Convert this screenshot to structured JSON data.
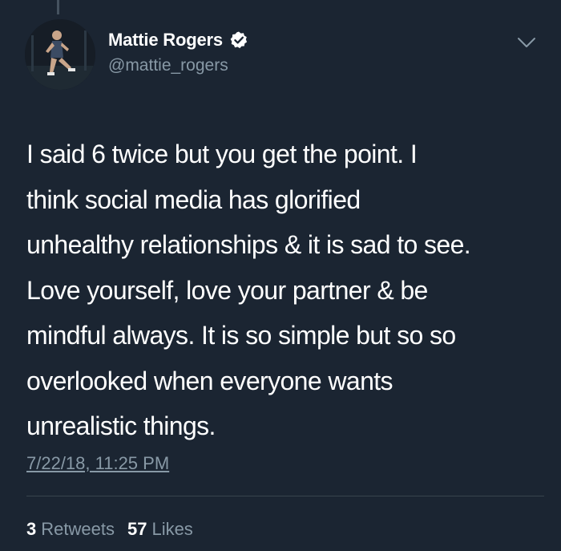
{
  "author": {
    "display_name": "Mattie Rogers",
    "handle": "@mattie_rogers",
    "verified": true
  },
  "tweet": {
    "lines": [
      "I said 6 twice but you get the point. I",
      "think social media has glorified",
      "unhealthy relationships & it is sad to see.",
      "Love yourself, love your partner & be",
      "mindful always. It is so simple but so so",
      "overlooked when everyone wants",
      "unrealistic things."
    ],
    "timestamp": "7/22/18, 11:25 PM"
  },
  "stats": {
    "retweets_count": "3",
    "retweets_label": "Retweets",
    "likes_count": "57",
    "likes_label": "Likes"
  },
  "icons": {
    "verified": "verified-badge-icon",
    "menu": "chevron-down-icon"
  },
  "colors": {
    "background": "#1b2532",
    "text_primary": "#ffffff",
    "text_secondary": "#8899a6",
    "divider": "#38444d"
  }
}
